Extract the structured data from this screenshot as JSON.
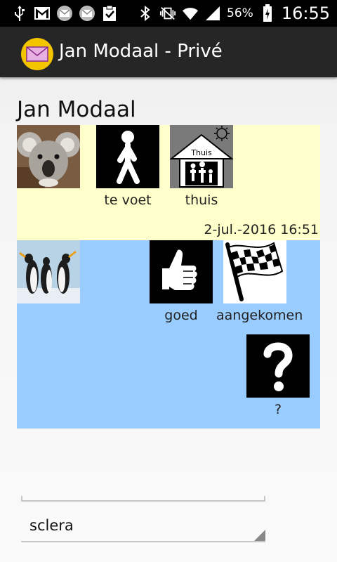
{
  "status_bar": {
    "icons_left": [
      "usb-icon",
      "gmail-icon",
      "mail-icon",
      "mail-icon",
      "clipboard-check-icon"
    ],
    "icons_right": [
      "bluetooth-icon",
      "vibrate-icon",
      "wifi-icon",
      "signal-icon"
    ],
    "battery_percent": "56%",
    "battery_level": 0.56,
    "time": "16:55"
  },
  "action_bar": {
    "title": "Jan Modaal - Privé",
    "icon": "mail-envelope-icon",
    "accent": "#f2c500"
  },
  "page": {
    "title": "Jan Modaal"
  },
  "messages": [
    {
      "background": "#ffffcc",
      "sender_avatar": "koala-photo",
      "pictograms": [
        {
          "icon": "walking-person-pictogram",
          "label": "te voet"
        },
        {
          "icon": "house-family-pictogram",
          "label": "thuis",
          "house_text": "Thuis"
        }
      ],
      "timestamp": "2-jul.-2016 16:51"
    },
    {
      "background": "#99ccff",
      "sender_avatar": "penguins-photo",
      "pictograms": [
        {
          "icon": "thumbs-up-pictogram",
          "label": "goed"
        },
        {
          "icon": "checkered-flag-pictogram",
          "label": "aangekomen"
        },
        {
          "icon": "question-mark-pictogram",
          "label": "?"
        }
      ]
    }
  ],
  "spinner": {
    "value": "sclera"
  }
}
